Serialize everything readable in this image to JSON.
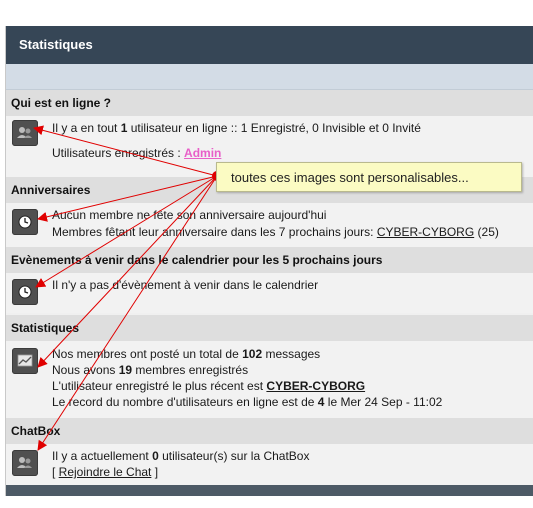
{
  "header": {
    "title": "Statistiques"
  },
  "sections": {
    "online": {
      "title": "Qui est en ligne ?",
      "line1": {
        "a": "Il y a en tout ",
        "b": "1",
        "c": " utilisateur en ligne :: 1 Enregistré, 0 Invisible et 0 Invité"
      },
      "line2": {
        "a": "Utilisateurs enregistrés : ",
        "link": "Admin"
      },
      "icon": "users-icon"
    },
    "birthdays": {
      "title": "Anniversaires",
      "line1": "Aucun membre ne fête son anniversaire aujourd'hui",
      "line2": {
        "a": "Membres fêtant leur anniversaire dans les 7 prochains jours: ",
        "link": "CYBER-CYBORG",
        "c": " (25)"
      },
      "icon": "clock-icon"
    },
    "events": {
      "title": "Evènements à venir dans le calendrier pour les 5 prochains jours",
      "line1": "Il n'y a pas d'évènement à venir dans le calendrier",
      "icon": "clock-icon"
    },
    "stats": {
      "title": "Statistiques",
      "line1": {
        "a": "Nos membres ont posté un total de ",
        "b": "102",
        "c": " messages"
      },
      "line2": {
        "a": "Nous avons ",
        "b": "19",
        "c": " membres enregistrés"
      },
      "line3": {
        "a": "L'utilisateur enregistré le plus récent est ",
        "link": "CYBER-CYBORG"
      },
      "line4": {
        "a": "Le record du nombre d'utilisateurs en ligne est de ",
        "b": "4",
        "c": " le Mer 24 Sep - 11:02"
      },
      "icon": "chart-icon"
    },
    "chatbox": {
      "title": "ChatBox",
      "line1": {
        "a": "Il y a actuellement ",
        "b": "0",
        "c": " utilisateur(s) sur la ChatBox"
      },
      "line2": {
        "a": "[ ",
        "link": "Rejoindre le Chat",
        "c": " ]"
      },
      "icon": "users-icon"
    }
  },
  "tooltip": {
    "text": "toutes ces images sont personalisables..."
  },
  "colors": {
    "header": "#364656",
    "arrow": "#e00000",
    "tooltip": "#fbfbc3",
    "admin_link": "#e85fc8"
  }
}
